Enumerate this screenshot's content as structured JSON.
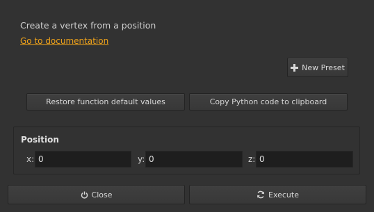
{
  "header": {
    "description": "Create a vertex from a position",
    "doc_link": "Go to documentation"
  },
  "presets": {
    "new_preset_label": "New Preset"
  },
  "actions": {
    "restore_label": "Restore function default values",
    "copy_label": "Copy Python code to clipboard"
  },
  "position": {
    "title": "Position",
    "x_label": "x:",
    "x_value": "0",
    "y_label": "y:",
    "y_value": "0",
    "z_label": "z:",
    "z_value": "0"
  },
  "footer": {
    "close_label": "Close",
    "execute_label": "Execute"
  },
  "colors": {
    "background": "#323232",
    "link": "#f0a31a",
    "field_bg": "#1e1e1e"
  },
  "icons": {
    "new_preset": "plus-icon",
    "close": "power-icon",
    "execute": "refresh-icon"
  }
}
